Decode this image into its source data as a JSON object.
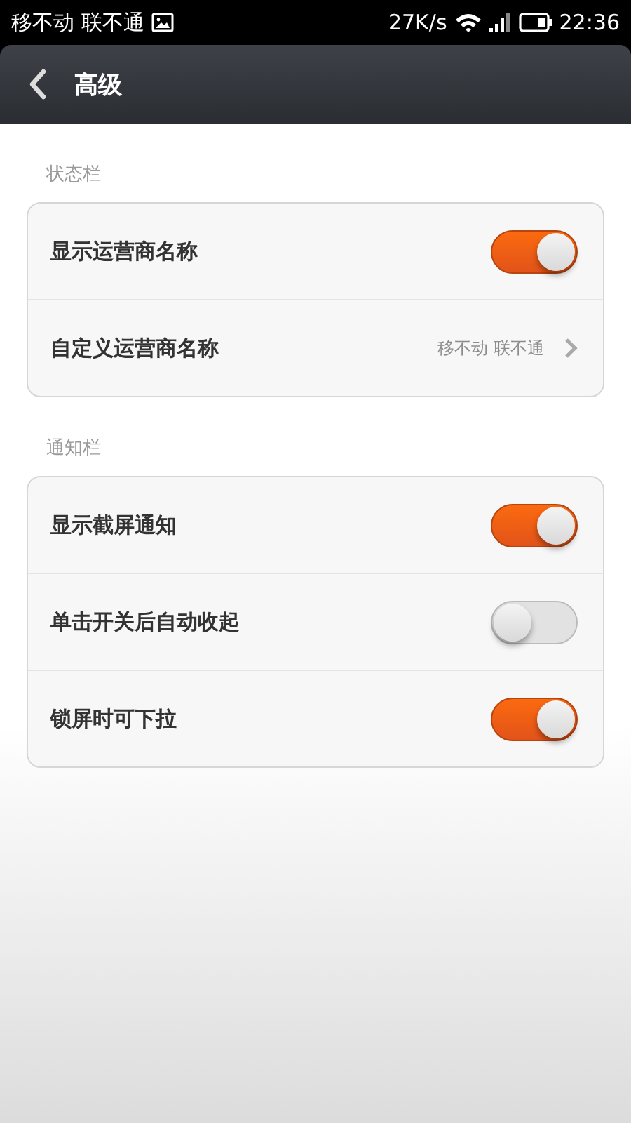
{
  "status_bar": {
    "carrier": "移不动 联不通",
    "speed": "27K/s",
    "time": "22:36"
  },
  "header": {
    "title": "高级"
  },
  "sections": [
    {
      "title": "状态栏",
      "items": [
        {
          "kind": "toggle",
          "label": "显示运营商名称",
          "on": true
        },
        {
          "kind": "link",
          "label": "自定义运营商名称",
          "value": "移不动 联不通"
        }
      ]
    },
    {
      "title": "通知栏",
      "items": [
        {
          "kind": "toggle",
          "label": "显示截屏通知",
          "on": true
        },
        {
          "kind": "toggle",
          "label": "单击开关后自动收起",
          "on": false
        },
        {
          "kind": "toggle",
          "label": "锁屏时可下拉",
          "on": true
        }
      ]
    }
  ]
}
